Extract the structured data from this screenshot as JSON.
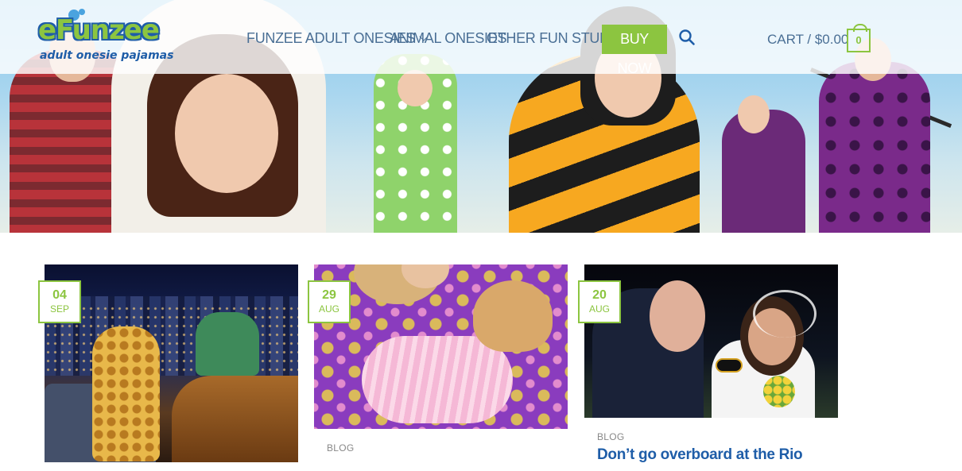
{
  "brand": {
    "logo_main": "eFunzee",
    "logo_sub": "adult onesie pajamas"
  },
  "nav": {
    "items": [
      {
        "label": "FUNZEE ADULT ONESIES",
        "has_dropdown": true
      },
      {
        "label": "ANIMAL ONESIES",
        "has_dropdown": false
      },
      {
        "label": "OTHER FUN STUFF",
        "has_dropdown": true
      }
    ],
    "buy_now": "BUY NOW",
    "search_icon": "search-icon"
  },
  "cart": {
    "label": "CART /",
    "total": "$0.00",
    "count": "0"
  },
  "colors": {
    "accent_green": "#8cc540",
    "nav_text": "#4a6f95",
    "title_blue": "#1e5da8"
  },
  "posts": [
    {
      "day": "04",
      "month": "SEP",
      "category": "",
      "title": ""
    },
    {
      "day": "29",
      "month": "AUG",
      "category": "BLOG",
      "title": ""
    },
    {
      "day": "20",
      "month": "AUG",
      "category": "BLOG",
      "title": "Don’t go overboard at the Rio"
    }
  ]
}
